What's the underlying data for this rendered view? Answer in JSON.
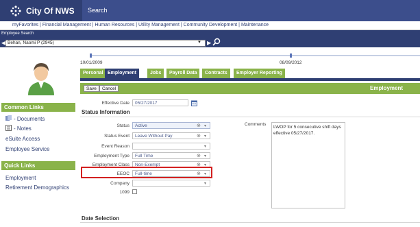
{
  "brand": {
    "title": "City Of NWS",
    "search_label": "Search"
  },
  "menu": {
    "text": "myFavorites  |  Financial Management  |  Human Resources  |  Utility Management  |  Community Development  |  Maintenance"
  },
  "employee_search": {
    "label": "Employee Search",
    "selected": "Behan, Naomi P (2945)"
  },
  "sidebar": {
    "common_title": "Common Links",
    "common_links": [
      "- Documents",
      "- Notes",
      "eSuite Access",
      "Employee Service"
    ],
    "quick_title": "Quick Links",
    "quick_links": [
      "Employment",
      "Retirement Demographics"
    ]
  },
  "timeline": {
    "start": "10/01/2009",
    "end": "08/09/2012"
  },
  "tabs": [
    "Personal",
    "Employment",
    "Jobs",
    "Payroll Data",
    "Contracts",
    "Employer Reporting"
  ],
  "toolbar": {
    "save": "Save",
    "cancel": "Cancel",
    "title": "Employment"
  },
  "form": {
    "effective_date_label": "Effective Date",
    "effective_date": "05/27/2017",
    "status_header": "Status Information",
    "status_label": "Status",
    "status_value": "Active",
    "status_event_label": "Status Event",
    "status_event_value": "Leave Without Pay",
    "event_reason_label": "Event Reason",
    "event_reason_value": "",
    "emp_type_label": "Employment Type",
    "emp_type_value": "Full Time",
    "emp_class_label": "Employment Class",
    "emp_class_value": "Non-Exempt",
    "eeoc_label": "EEOC",
    "eeoc_value": "Full-time",
    "company_label": "Company",
    "company_value": "",
    "field_1099_label": "1099",
    "comments_label": "Comments",
    "comments_value": "LWOP for 5 consecutive shift days effective 05/27/2017.",
    "date_selection_header": "Date Selection"
  },
  "colors": {
    "navy": "#2f3f73",
    "green": "#8ab34a",
    "highlight": "#d32020"
  }
}
